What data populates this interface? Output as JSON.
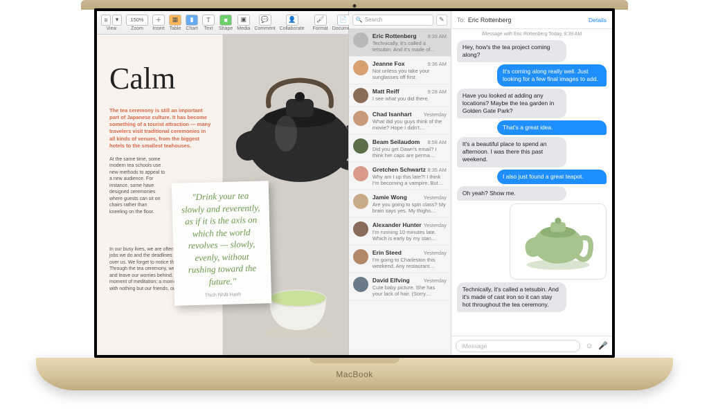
{
  "device_label": "MacBook",
  "pages": {
    "toolbar": {
      "view": "View",
      "zoom": "Zoom",
      "zoom_value": "150%",
      "insert": "Insert",
      "table": "Table",
      "chart": "Chart",
      "text": "Text",
      "shape": "Shape",
      "media": "Media",
      "comment": "Comment",
      "collaborate": "Collaborate",
      "format": "Format",
      "document": "Document"
    },
    "doc": {
      "title": "Calm",
      "intro": "The tea ceremony is still an important part of Japanese culture. It has become something of a tourist attraction — many travelers visit traditional ceremonies in all kinds of venues, from the biggest hotels to the smallest teahouses.",
      "body1": "At the same time, some modern tea schools use new methods to appeal to a new audience. For instance, some have designed ceremonies where guests can sit on chairs rather than kneeling on the floor.",
      "body2": "In our busy lives, we are often focused on the jobs we do and the deadlines that are looming over us. We forget to notice the tea in our lives. Through the tea ceremony, we can slow down and leave our worries behind. We can take a moment of meditation; a moment of calmness, with nothing but our friends, our tea, and the",
      "quote": "\"Drink your tea slowly and reverently, as if it is the axis on which the world revolves — slowly, evenly, without rushing toward the future.\"",
      "quote_author": "Thich Nhất Hạnh"
    }
  },
  "messages": {
    "search_placeholder": "Search",
    "to_label": "To:",
    "recipient": "Eric Rottenberg",
    "details": "Details",
    "sub": "iMessage with Eric Rottenberg\nToday, 9:39 AM",
    "compose_placeholder": "iMessage",
    "conversations": [
      {
        "name": "Eric Rottenberg",
        "time": "9:39 AM",
        "preview": "Technically, it's called a tetsubin. And it's made of…",
        "avatar": "#b8b8b8"
      },
      {
        "name": "Jeanne Fox",
        "time": "9:36 AM",
        "preview": "Not unless you take your sunglasses off first.",
        "avatar": "#d8a070"
      },
      {
        "name": "Matt Reiff",
        "time": "9:28 AM",
        "preview": "I see what you did there.",
        "avatar": "#8c6b55"
      },
      {
        "name": "Chad Isanhart",
        "time": "Yesterday",
        "preview": "What did you guys think of the movie? Hope I didn't…",
        "avatar": "#c99a7a"
      },
      {
        "name": "Beam Seilaudom",
        "time": "8:58 AM",
        "preview": "Did you get Dawn's email? I think her caps are perma…",
        "avatar": "#5a6e4a"
      },
      {
        "name": "Gretchen Schwartz",
        "time": "8:35 AM",
        "preview": "Why am I up this late?! I think I'm becoming a vampire. But…",
        "avatar": "#d99a88"
      },
      {
        "name": "Jamie Wong",
        "time": "Yesterday",
        "preview": "Are you going to spin class? My brain says yes. My thighs…",
        "avatar": "#c8a988"
      },
      {
        "name": "Alexander Hunter",
        "time": "Yesterday",
        "preview": "I'm running 10 minutes late. Which is early by my stan…",
        "avatar": "#8a6a5a"
      },
      {
        "name": "Erin Steed",
        "time": "Yesterday",
        "preview": "I'm going to Charleston this weekend. Any restaurant…",
        "avatar": "#b38868"
      },
      {
        "name": "David Elfving",
        "time": "Yesterday",
        "preview": "Cute baby picture. She has your lack of hair. (Sorry…",
        "avatar": "#6a7a88"
      }
    ],
    "thread": [
      {
        "dir": "in",
        "text": "Hey, how's the tea project coming along?"
      },
      {
        "dir": "out",
        "text": "It's coming along really well. Just looking for a few final images to add."
      },
      {
        "dir": "in",
        "text": "Have you looked at adding any locations? Maybe the tea garden in Golden Gate Park?"
      },
      {
        "dir": "out",
        "text": "That's a great idea."
      },
      {
        "dir": "in",
        "text": "It's a beautiful place to spend an afternoon. I was there this past weekend."
      },
      {
        "dir": "out",
        "text": "I also just found a great teapot."
      },
      {
        "dir": "in",
        "text": "Oh yeah? Show me."
      },
      {
        "dir": "att"
      },
      {
        "dir": "in",
        "text": "Technically, it's called a tetsubin. And it's made of cast iron so it can stay hot throughout the tea ceremony."
      }
    ]
  }
}
